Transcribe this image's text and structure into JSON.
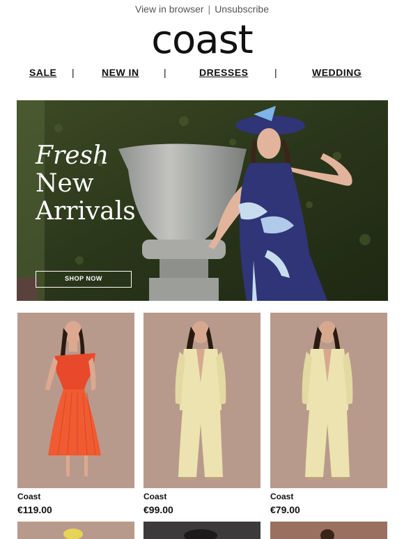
{
  "header": {
    "view_in_browser": "View in browser",
    "separator": "|",
    "unsubscribe": "Unsubscribe",
    "logo": "coast"
  },
  "nav": {
    "items": [
      {
        "label": "SALE"
      },
      {
        "label": "NEW IN"
      },
      {
        "label": "DRESSES"
      },
      {
        "label": "WEDDING"
      }
    ],
    "divider": "|"
  },
  "hero": {
    "title_line1": "Fresh",
    "title_line2": "New",
    "title_line3": "Arrivals",
    "cta": "SHOP NOW"
  },
  "products": [
    {
      "brand": "Coast",
      "price": "€119.00",
      "image": "orange-pleated-dress"
    },
    {
      "brand": "Coast",
      "price": "€99.00",
      "image": "lemon-satin-suit"
    },
    {
      "brand": "Coast",
      "price": "€79.00",
      "image": "lemon-satin-suit"
    }
  ],
  "colors": {
    "text": "#111111",
    "product_bg": "#b89a8c",
    "hero_hedge": "#2e3a1e",
    "dress_orange": "#e8492a",
    "suit_lemon": "#ece3b0",
    "navy_dress": "#2f3576"
  }
}
